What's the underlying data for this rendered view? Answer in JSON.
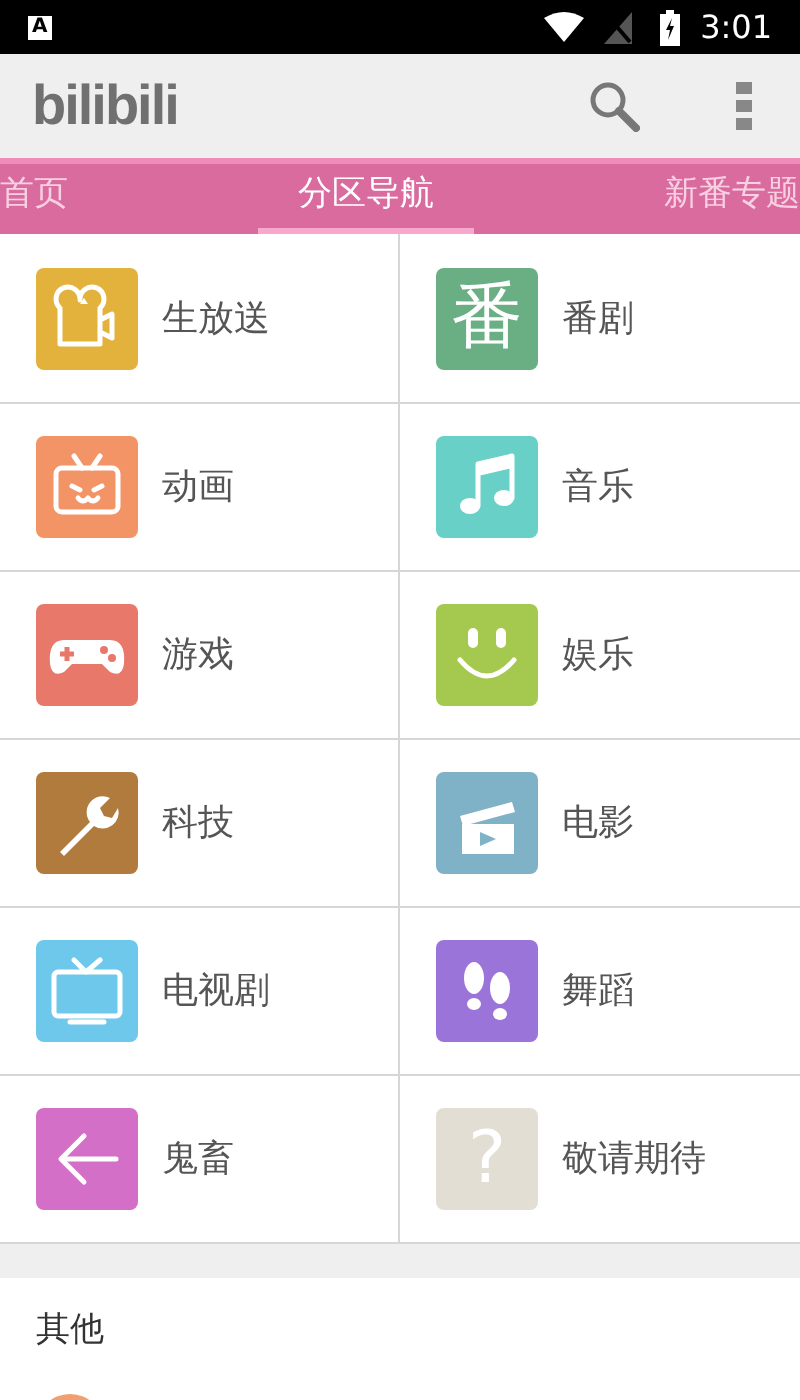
{
  "status_bar": {
    "notification": "A",
    "time": "3:01"
  },
  "toolbar": {
    "logo": "bilibili"
  },
  "tabs": [
    {
      "label": "首页",
      "selected": false
    },
    {
      "label": "分区导航",
      "selected": true
    },
    {
      "label": "新番专题",
      "selected": false
    }
  ],
  "categories": [
    {
      "label": "生放送",
      "kind": "camera",
      "color": "#e3b23c"
    },
    {
      "label": "番剧",
      "kind": "glyph",
      "glyph": "番",
      "color": "#6aaf83"
    },
    {
      "label": "动画",
      "kind": "tv",
      "color": "#f39466"
    },
    {
      "label": "音乐",
      "kind": "note",
      "color": "#69d0c8"
    },
    {
      "label": "游戏",
      "kind": "gamepad",
      "color": "#e8786a"
    },
    {
      "label": "娱乐",
      "kind": "smile",
      "color": "#a5c84f"
    },
    {
      "label": "科技",
      "kind": "wrench",
      "color": "#b07b3c"
    },
    {
      "label": "电影",
      "kind": "clapper",
      "color": "#7fb1c7"
    },
    {
      "label": "电视剧",
      "kind": "screen",
      "color": "#6dc8ec"
    },
    {
      "label": "舞蹈",
      "kind": "footprints",
      "color": "#9b74da"
    },
    {
      "label": "鬼畜",
      "kind": "back",
      "color": "#d36fc6"
    },
    {
      "label": "敬请期待",
      "kind": "glyph",
      "glyph": "?",
      "color": "#e2ded4"
    }
  ],
  "other_section": {
    "title": "其他"
  }
}
